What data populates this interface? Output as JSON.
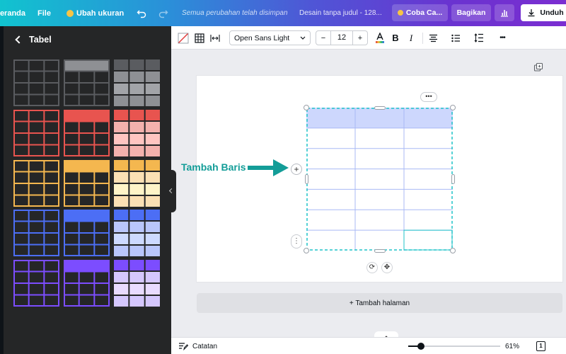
{
  "topbar": {
    "home": "Beranda",
    "file": "File",
    "resize": "Ubah ukuran",
    "undo_icon": "undo-icon",
    "redo_icon": "redo-icon",
    "save_status": "Semua perubahan telah disimpan",
    "doc_title": "Desain tanpa judul - 128...",
    "try_pro": "Coba Ca...",
    "share": "Bagikan",
    "insights_icon": "bar-chart-icon",
    "download": "Unduh"
  },
  "panel": {
    "back_label": "Tabel",
    "templates": [
      {
        "color": "#5a5c60",
        "header": "#8e9094",
        "style": "grid"
      },
      {
        "color": "#5a5c60",
        "header": "#8e9094",
        "style": "header"
      },
      {
        "color": "#5a5c60",
        "header": "#8e9094",
        "style": "filled"
      },
      {
        "color": "#e8544f",
        "header": "#e8544f",
        "style": "grid"
      },
      {
        "color": "#e8544f",
        "header": "#e8544f",
        "style": "header"
      },
      {
        "color": "#e8544f",
        "header": "#f3b1ad",
        "style": "filled"
      },
      {
        "color": "#f4b74f",
        "header": "#f4b74f",
        "style": "grid"
      },
      {
        "color": "#f4b74f",
        "header": "#f4b74f",
        "style": "header"
      },
      {
        "color": "#f4b74f",
        "header": "#fbe0b4",
        "style": "filled"
      },
      {
        "color": "#4c6ef5",
        "header": "#4c6ef5",
        "style": "grid"
      },
      {
        "color": "#4c6ef5",
        "header": "#4c6ef5",
        "style": "header"
      },
      {
        "color": "#4c6ef5",
        "header": "#b9c6fb",
        "style": "filled"
      },
      {
        "color": "#7c4dff",
        "header": "#7c4dff",
        "style": "grid"
      },
      {
        "color": "#7c4dff",
        "header": "#7c4dff",
        "style": "header"
      },
      {
        "color": "#7c4dff",
        "header": "#d5c7fd",
        "style": "filled"
      }
    ]
  },
  "editbar": {
    "font_name": "Open Sans Light",
    "font_size": "12",
    "minus": "−",
    "plus": "+",
    "more": "•••"
  },
  "table": {
    "rows": 7,
    "cols": 3,
    "header_fill": "#cdd7fd",
    "line_color": "#a9b9f5",
    "selection_color": "#1fc3c9"
  },
  "canvas": {
    "annotation": "Tambah Baris",
    "annotation_color": "#139d98",
    "add_page": "+ Tambah halaman",
    "more_pill": "•••",
    "add_row": "+",
    "row_menu": "⋮",
    "rotate": "⟳",
    "move": "✥"
  },
  "footer": {
    "notes": "Catatan",
    "zoom": "61%",
    "zoom_fraction": 0.14,
    "page_count": "1"
  }
}
